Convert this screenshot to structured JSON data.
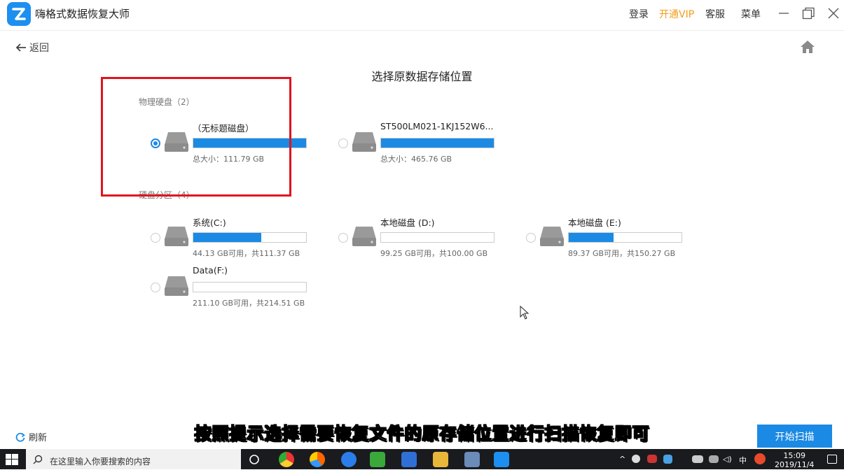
{
  "titlebar": {
    "app_title": "嗨格式数据恢复大师",
    "login": "登录",
    "vip": "开通VIP",
    "service": "客服",
    "menu": "菜单"
  },
  "nav": {
    "back_label": "返回"
  },
  "page_title": "选择原数据存储位置",
  "physical": {
    "label": "物理硬盘（2）",
    "disks": [
      {
        "name": "（无标题磁盘）",
        "info": "总大小：111.79 GB",
        "fill": 1.0,
        "selected": true
      },
      {
        "name": "ST500LM021-1KJ152W6...",
        "info": "总大小：465.76 GB",
        "fill": 1.0,
        "selected": false
      }
    ]
  },
  "partitions": {
    "label": "硬盘分区（4）",
    "items": [
      {
        "name": "系统(C:)",
        "info": "44.13 GB可用，共111.37 GB",
        "fill": 0.6
      },
      {
        "name": "本地磁盘 (D:)",
        "info": "99.25 GB可用，共100.00 GB",
        "fill": 0.0
      },
      {
        "name": "本地磁盘 (E:)",
        "info": "89.37 GB可用，共150.27 GB",
        "fill": 0.4
      },
      {
        "name": "Data(F:)",
        "info": "211.10 GB可用，共214.51 GB",
        "fill": 0.0
      }
    ]
  },
  "footer": {
    "refresh": "刷新",
    "scan": "开始扫描"
  },
  "caption": "按照提示选择需要恢复文件的原存储位置进行扫描恢复即可",
  "taskbar": {
    "search_placeholder": "在这里输入你要搜索的内容",
    "ime": "中",
    "time": "15:09",
    "date": "2019/11/4"
  },
  "colors": {
    "accent": "#1b8ae4",
    "vip": "#f39b1b",
    "highlight": "#e0141e"
  }
}
